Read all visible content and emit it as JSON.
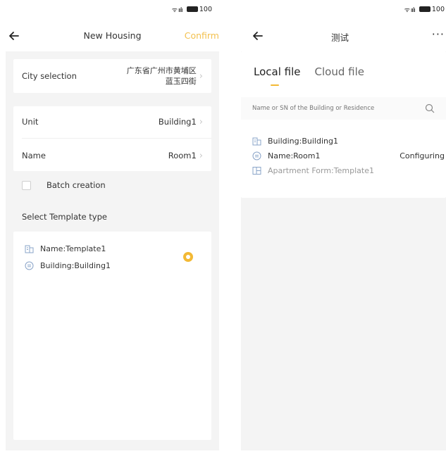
{
  "status_bar": {
    "signal": "ᯤ ıılı",
    "battery": "100"
  },
  "left": {
    "nav": {
      "title": "New Housing",
      "confirm_label": "Confirm"
    },
    "city": {
      "label": "City selection",
      "value_line1": "广东省广州市黄埔区",
      "value_line2": "蓝玉四街"
    },
    "unit": {
      "label": "Unit",
      "value": "Building1"
    },
    "name": {
      "label": "Name",
      "value": "Room1"
    },
    "batch": {
      "label": "Batch creation"
    },
    "template_section": {
      "title": "Select Template type"
    },
    "template": {
      "name": "Name:Template1",
      "building": "Building:Building1"
    }
  },
  "right": {
    "nav": {
      "title": "测试",
      "more": "···"
    },
    "tabs": [
      {
        "label": "Local file"
      },
      {
        "label": "Cloud file"
      }
    ],
    "search": {
      "placeholder": "Name or SN of the Building or Residence"
    },
    "item": {
      "building": "Building:Building1",
      "name": "Name:Room1",
      "status": "Configuring",
      "apartment_form": "Apartment Form:Template1"
    }
  },
  "colors": {
    "accent": "#f3b935",
    "background": "#f4f4f4",
    "muted": "#999999"
  },
  "icons": [
    "back-arrow-icon",
    "chevron-right-icon",
    "building-icon",
    "name-icon",
    "apartment-form-icon",
    "search-icon",
    "more-icon",
    "wifi-icon",
    "signal-icon",
    "battery-icon"
  ]
}
